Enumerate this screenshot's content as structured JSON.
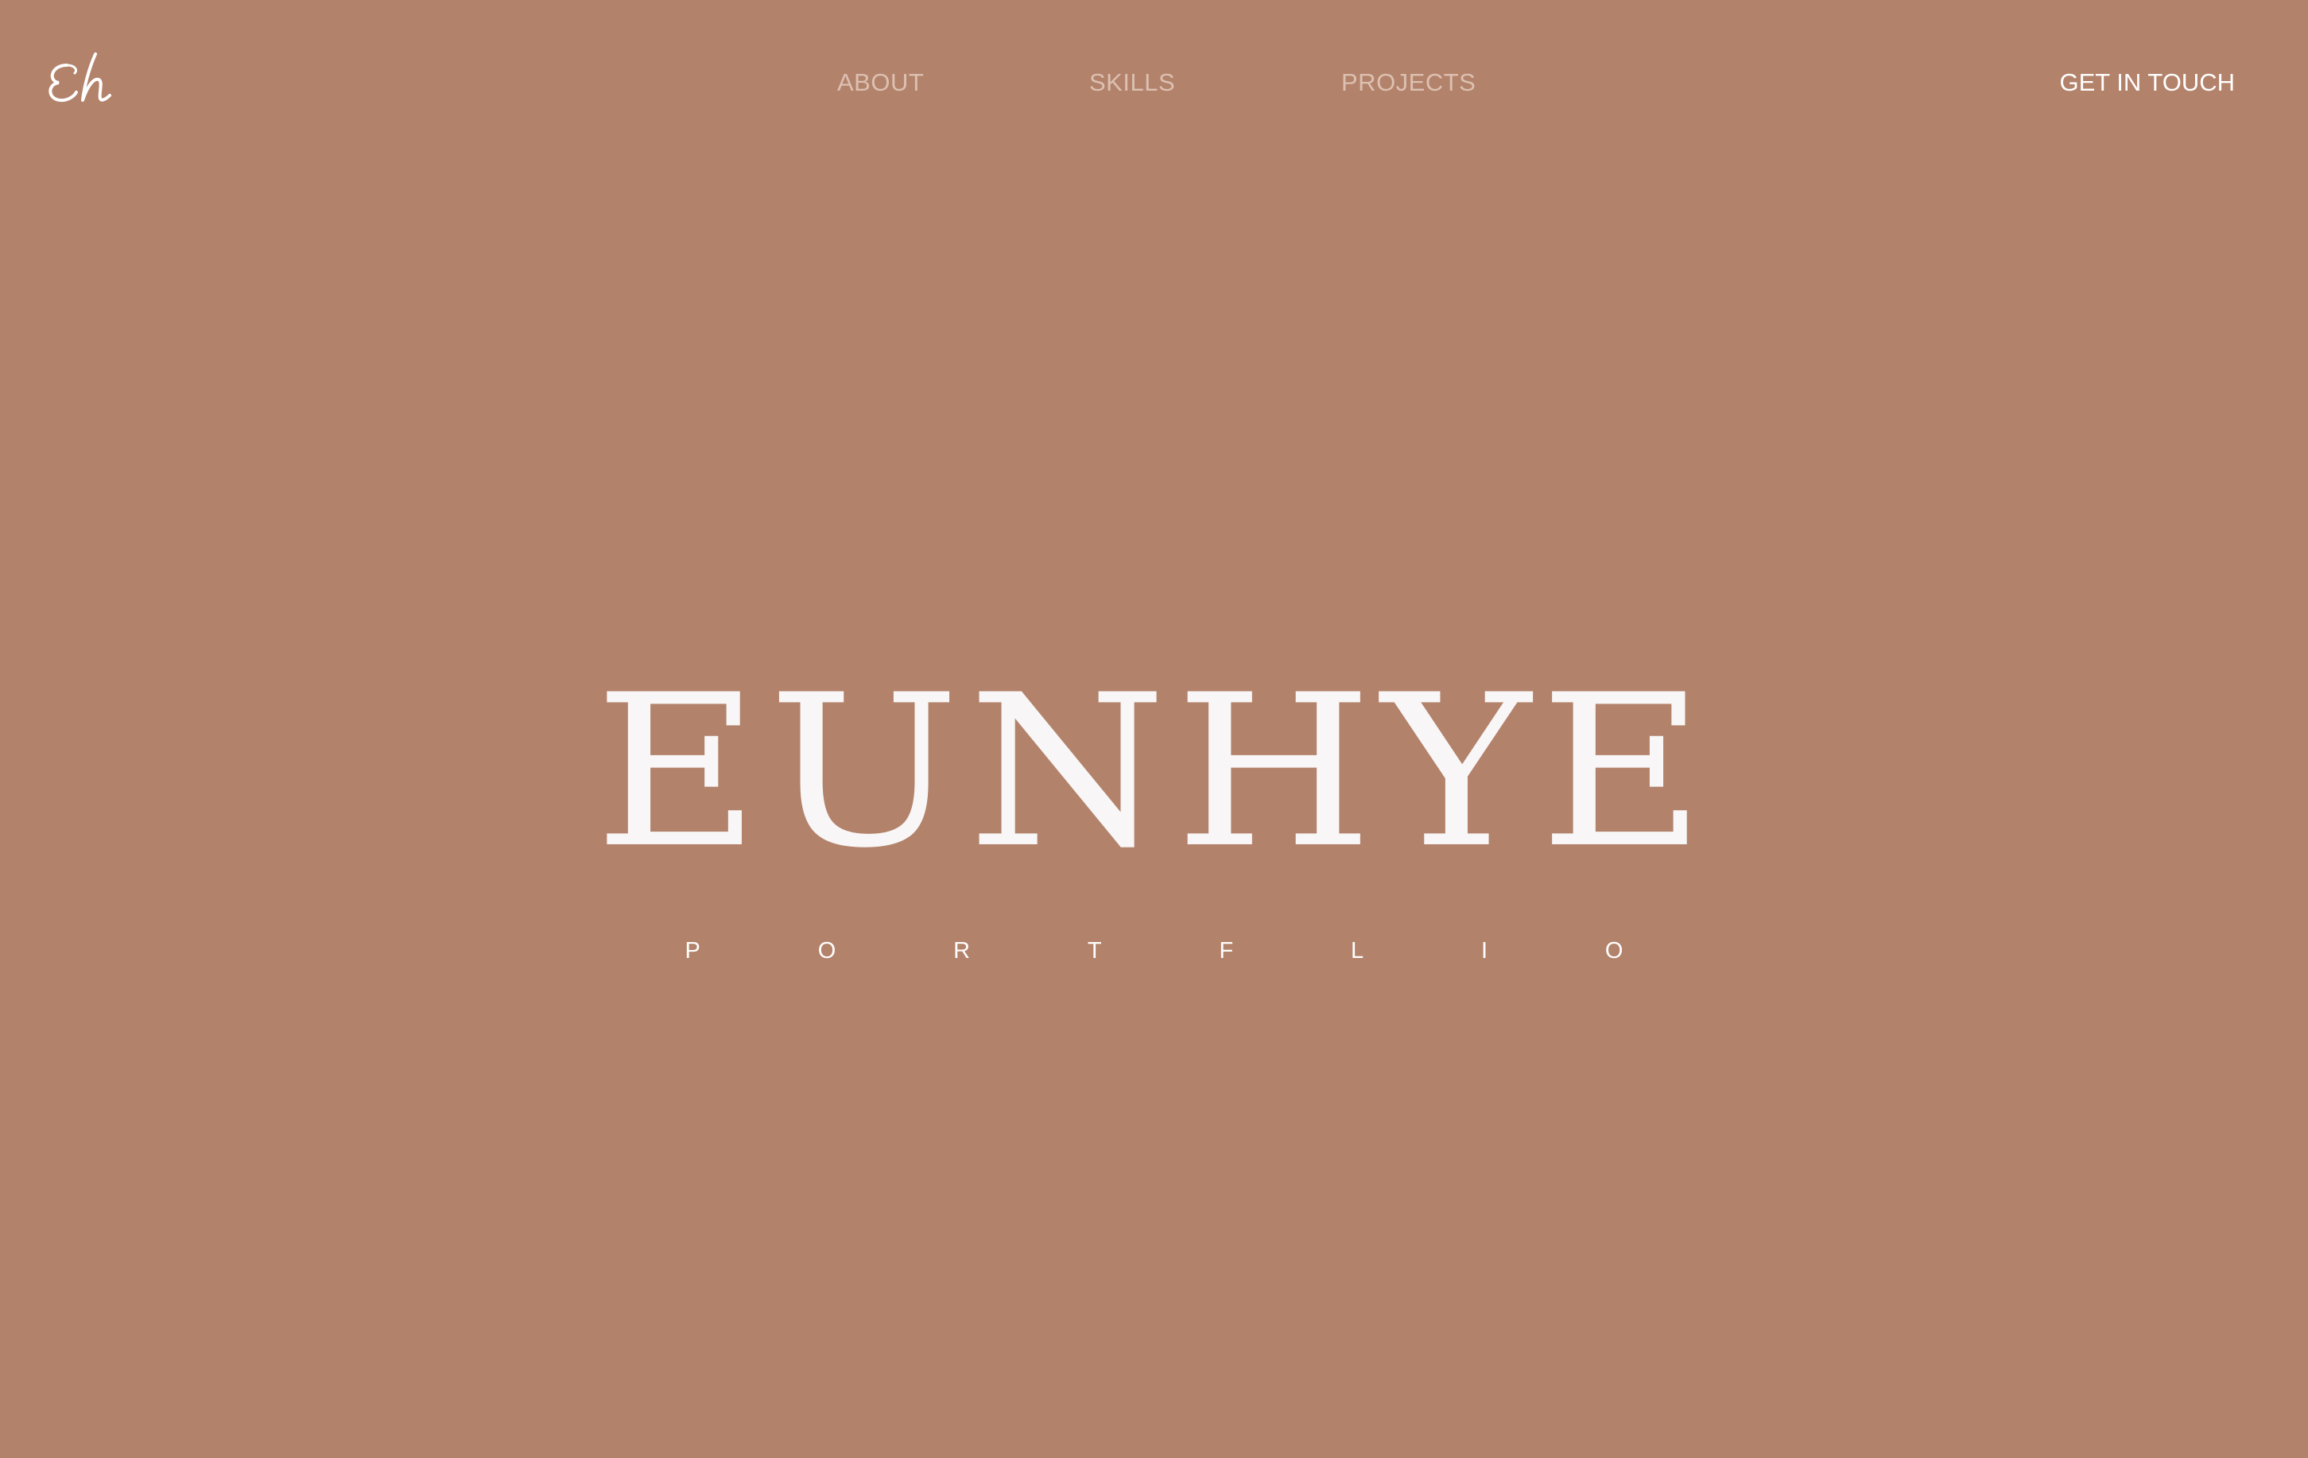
{
  "header": {
    "logo_text": "Eh",
    "nav": [
      {
        "label": "ABOUT"
      },
      {
        "label": "SKILLS"
      },
      {
        "label": "PROJECTS"
      }
    ],
    "cta_label": "GET IN TOUCH"
  },
  "hero": {
    "title": "EUNHYE",
    "subtitle_letters": [
      "P",
      "O",
      "R",
      "T",
      "F",
      "L",
      "I",
      "O"
    ]
  },
  "colors": {
    "background": "#b3826b",
    "nav_text": "#dcc0b1",
    "primary_text": "#ffffff"
  }
}
